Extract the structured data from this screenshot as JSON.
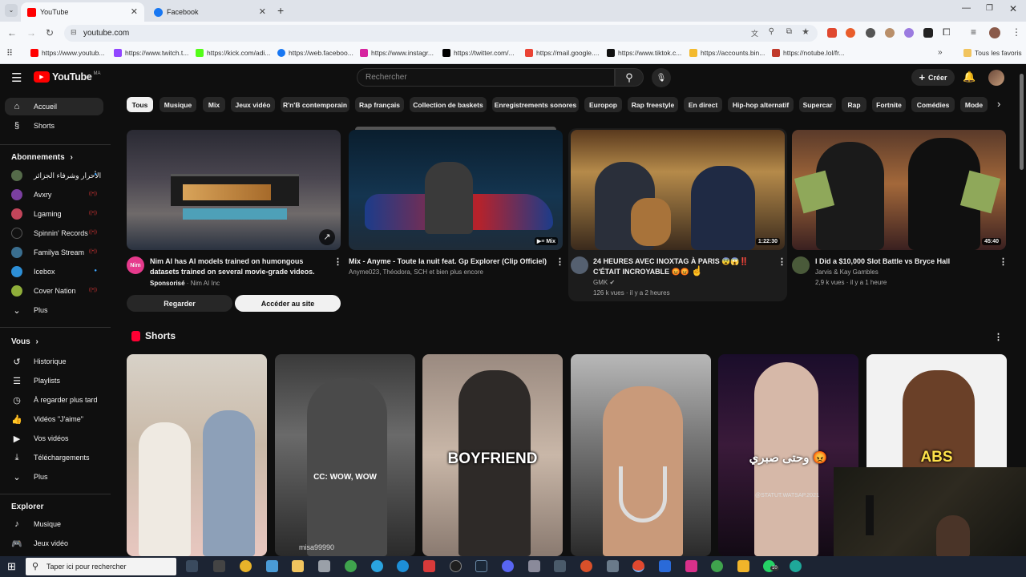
{
  "browser": {
    "tabs": [
      {
        "title": "YouTube",
        "active": true
      },
      {
        "title": "Facebook",
        "active": false
      }
    ],
    "url": "youtube.com",
    "bookmarks": [
      "https://www.youtub...",
      "https://www.twitch.t...",
      "https://kick.com/adi...",
      "https://web.faceboo...",
      "https://www.instagr...",
      "https://twitter.com/...",
      "https://mail.google....",
      "https://www.tiktok.c...",
      "https://accounts.bin...",
      "https://notube.lol/fr..."
    ],
    "all_bookmarks_label": "Tous les favoris"
  },
  "youtube": {
    "logo_text": "YouTube",
    "logo_region": "MA",
    "search_placeholder": "Rechercher",
    "create_label": "Créer",
    "sidebar": {
      "main": [
        {
          "label": "Accueil",
          "icon": "home-icon",
          "active": true
        },
        {
          "label": "Shorts",
          "icon": "shorts-icon"
        }
      ],
      "subscriptions_header": "Abonnements",
      "subscriptions": [
        {
          "label": "الأحرار وشرفاء الجزائر",
          "color": "#556b4a",
          "dot": "blue"
        },
        {
          "label": "Avxry",
          "color": "#7a3fa0",
          "dot": "red"
        },
        {
          "label": "Lgaming",
          "color": "#c2455a",
          "dot": "red"
        },
        {
          "label": "Spinnin' Records",
          "color": "#111111",
          "dot": "red"
        },
        {
          "label": "Familya Stream",
          "color": "#3a6e8f",
          "dot": "red"
        },
        {
          "label": "Icebox",
          "color": "#2d8fd6",
          "dot": "blue"
        },
        {
          "label": "Cover Nation",
          "color": "#8fae3a",
          "dot": "red"
        }
      ],
      "more_label": "Plus",
      "you_header": "Vous",
      "you_items": [
        {
          "label": "Historique",
          "icon": "history-icon"
        },
        {
          "label": "Playlists",
          "icon": "playlists-icon"
        },
        {
          "label": "À regarder plus tard",
          "icon": "clock-icon"
        },
        {
          "label": "Vidéos \"J'aime\"",
          "icon": "thumb-up-icon"
        },
        {
          "label": "Vos vidéos",
          "icon": "my-videos-icon"
        },
        {
          "label": "Téléchargements",
          "icon": "download-icon"
        },
        {
          "label": "Plus",
          "icon": "chevron-down-icon"
        }
      ],
      "explore_header": "Explorer",
      "explore_items": [
        {
          "label": "Musique",
          "icon": "music-icon"
        },
        {
          "label": "Jeux vidéo",
          "icon": "gamepad-icon"
        }
      ]
    },
    "chips": [
      "Tous",
      "Musique",
      "Mix",
      "Jeux vidéo",
      "R'n'B contemporain",
      "Rap français",
      "Collection de baskets",
      "Enregistrements sonores",
      "Europop",
      "Rap freestyle",
      "En direct",
      "Hip-hop alternatif",
      "Supercar",
      "Rap",
      "Fortnite",
      "Comédies",
      "Mode"
    ],
    "videos": [
      {
        "title": "Nim AI has AI models trained on humongous datasets trained on several movie-grade videos.",
        "sponsored": "Sponsorisé",
        "channel": "Nim AI Inc",
        "avatar_text": "Nim",
        "button_watch": "Regarder",
        "button_site": "Accéder au site"
      },
      {
        "title": "Mix - Anyme - Toute la nuit feat. Gp Explorer (Clip Officiel)",
        "meta": "Anyme023, Théodora, SCH et bien plus encore",
        "badge": "Mix"
      },
      {
        "title": "24 HEURES AVEC INOXTAG À PARIS 😨😱‼️ C'ÉTAIT INCROYABLE 😡😡",
        "channel": "GMK ✔",
        "stats": "126 k vues · il y a 2 heures",
        "duration": "1:22:30"
      },
      {
        "title": "I Did a $10,000 Slot Battle vs Bryce Hall",
        "channel": "Jarvis & Kay Gambles",
        "stats": "2,9 k vues · il y a 1 heure",
        "duration": "45:40"
      }
    ],
    "shorts_header": "Shorts",
    "shorts": [
      {
        "overlay": ""
      },
      {
        "overlay": "CC: WOW, WOW",
        "sub": "misa99990"
      },
      {
        "overlay": "BOYFRIEND"
      },
      {
        "overlay": ""
      },
      {
        "overlay": "وحتى صبري 😡",
        "sub": "@STATUT.WATSAP.2021"
      },
      {
        "overlay": "ABS"
      }
    ]
  },
  "taskbar": {
    "search_placeholder": "Taper ici pour rechercher",
    "badge_count": "10"
  }
}
